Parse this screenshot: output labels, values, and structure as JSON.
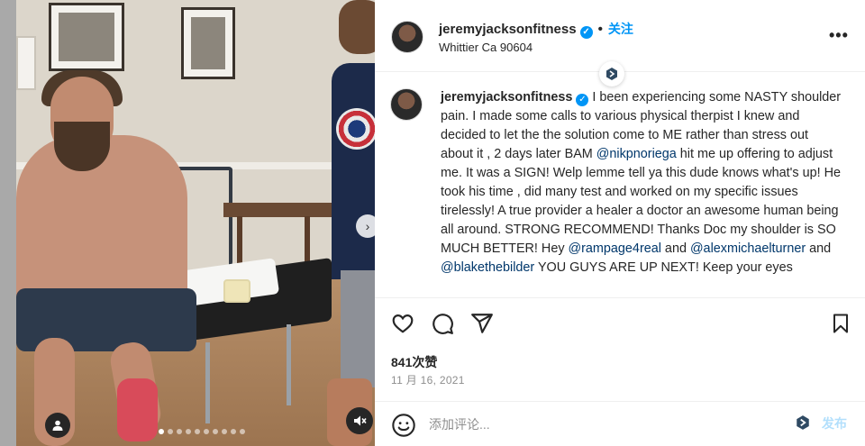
{
  "post": {
    "username": "jeremyjacksonfitness",
    "verified_mark": "✓",
    "bullet": "•",
    "follow_label": "关注",
    "location": "Whittier Ca 90604",
    "more_label": "•••"
  },
  "caption": {
    "username": "jeremyjacksonfitness",
    "verified_mark": "✓",
    "text_1": " I been experiencing some NASTY shoulder pain. I made some calls to various physical therpist I knew and decided to let the the solution come to ME rather than stress out about it , 2 days later BAM ",
    "mention_1": "@nikpnoriega",
    "text_2": " hit me up offering to adjust me. It was a SIGN! Welp lemme tell ya this dude knows what's up! He took his time , did many test and worked on my specific issues tirelessly! A true provider a healer a doctor an awesome human being all around. STRONG RECOMMEND! Thanks Doc my shoulder is SO MUCH BETTER! Hey ",
    "mention_2": "@rampage4real",
    "text_3": " and ",
    "mention_3": "@alexmichaelturner",
    "text_4": " and ",
    "mention_4": "@blakethebilder",
    "text_5": " YOU GUYS ARE UP NEXT! Keep your eyes"
  },
  "stats": {
    "likes": "841次赞",
    "date": "11 月 16, 2021"
  },
  "comment": {
    "placeholder": "添加评论...",
    "post_label": "发布"
  },
  "carousel": {
    "next_glyph": "›",
    "dot_count": 10,
    "active_index": 0
  },
  "icons": {
    "like": "heart-icon",
    "comment": "comment-icon",
    "share": "paper-plane-icon",
    "save": "bookmark-icon",
    "emoji": "smiley-icon",
    "tag": "user-tag-icon",
    "mute": "speaker-muted-icon",
    "extension": "extension-badge-icon"
  },
  "colors": {
    "link": "#0095f6",
    "mention": "#00376b",
    "muted": "#8e8e8e",
    "post_disabled": "#b2dffc"
  }
}
